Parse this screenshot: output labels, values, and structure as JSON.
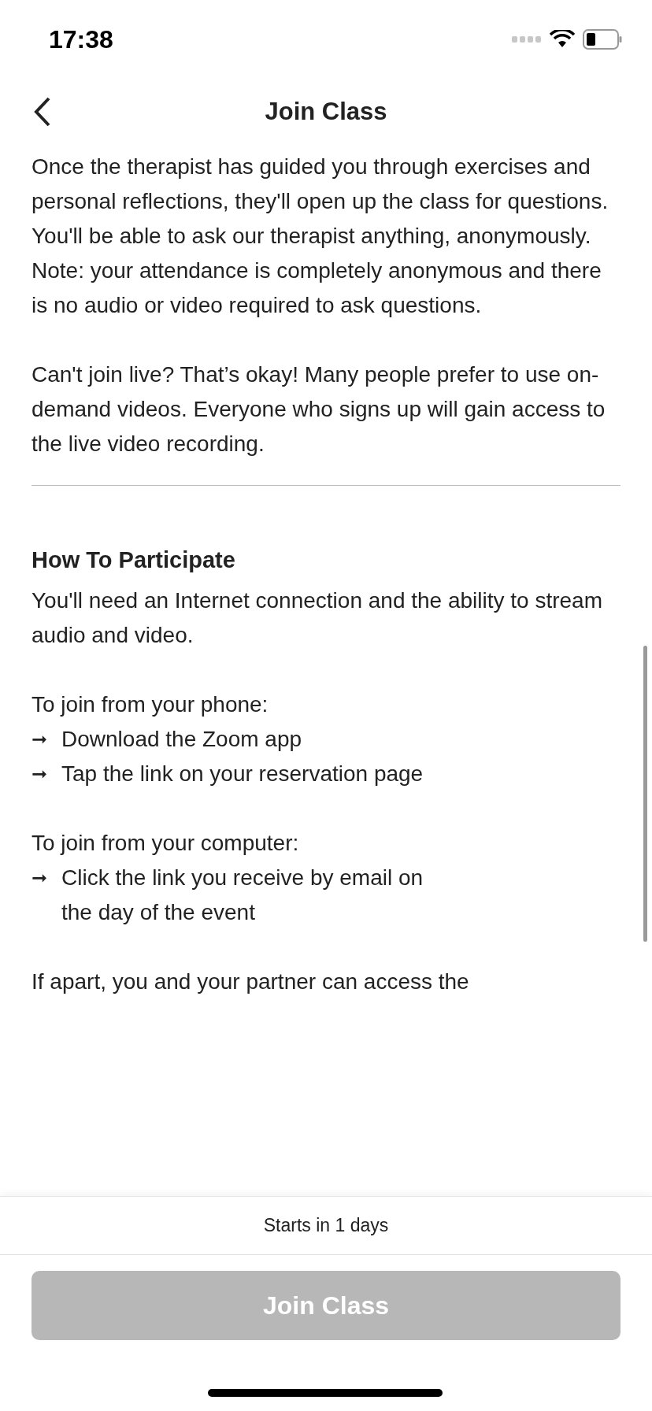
{
  "status_bar": {
    "time": "17:38"
  },
  "nav": {
    "title": "Join Class"
  },
  "content": [
    {
      "kind": "paragraph",
      "text": "Once the therapist has guided you through exercises and personal reflections, they'll open up the class for questions. You'll be able to ask our therapist anything, anonymously. Note: your attendance is completely anonymous and there is no audio or video required to ask questions."
    },
    {
      "kind": "paragraph",
      "text": "Can't join live? That’s okay! Many people prefer to use on-demand videos. Everyone who signs up will gain access to the live video recording."
    },
    {
      "kind": "divider"
    },
    {
      "kind": "heading",
      "text": "How To Participate"
    },
    {
      "kind": "text",
      "text": "You'll need an Internet connection and the ability to stream audio and video."
    },
    {
      "kind": "paragraph",
      "text": "To join from your phone:"
    },
    {
      "kind": "bullet",
      "marker": "➞",
      "text": "Download the Zoom app"
    },
    {
      "kind": "bullet",
      "marker": "➞",
      "text": "Tap the link on your reservation page"
    },
    {
      "kind": "paragraph",
      "text": "To join from your computer:"
    },
    {
      "kind": "bullet",
      "marker": "➞",
      "text": "Click the link you receive by email on the day of the event"
    },
    {
      "kind": "paragraph",
      "text": "If apart, you and your partner can access the"
    }
  ],
  "footer": {
    "countdown": "Starts in 1 days",
    "button": {
      "label": "Join Class",
      "disabled": true
    }
  }
}
